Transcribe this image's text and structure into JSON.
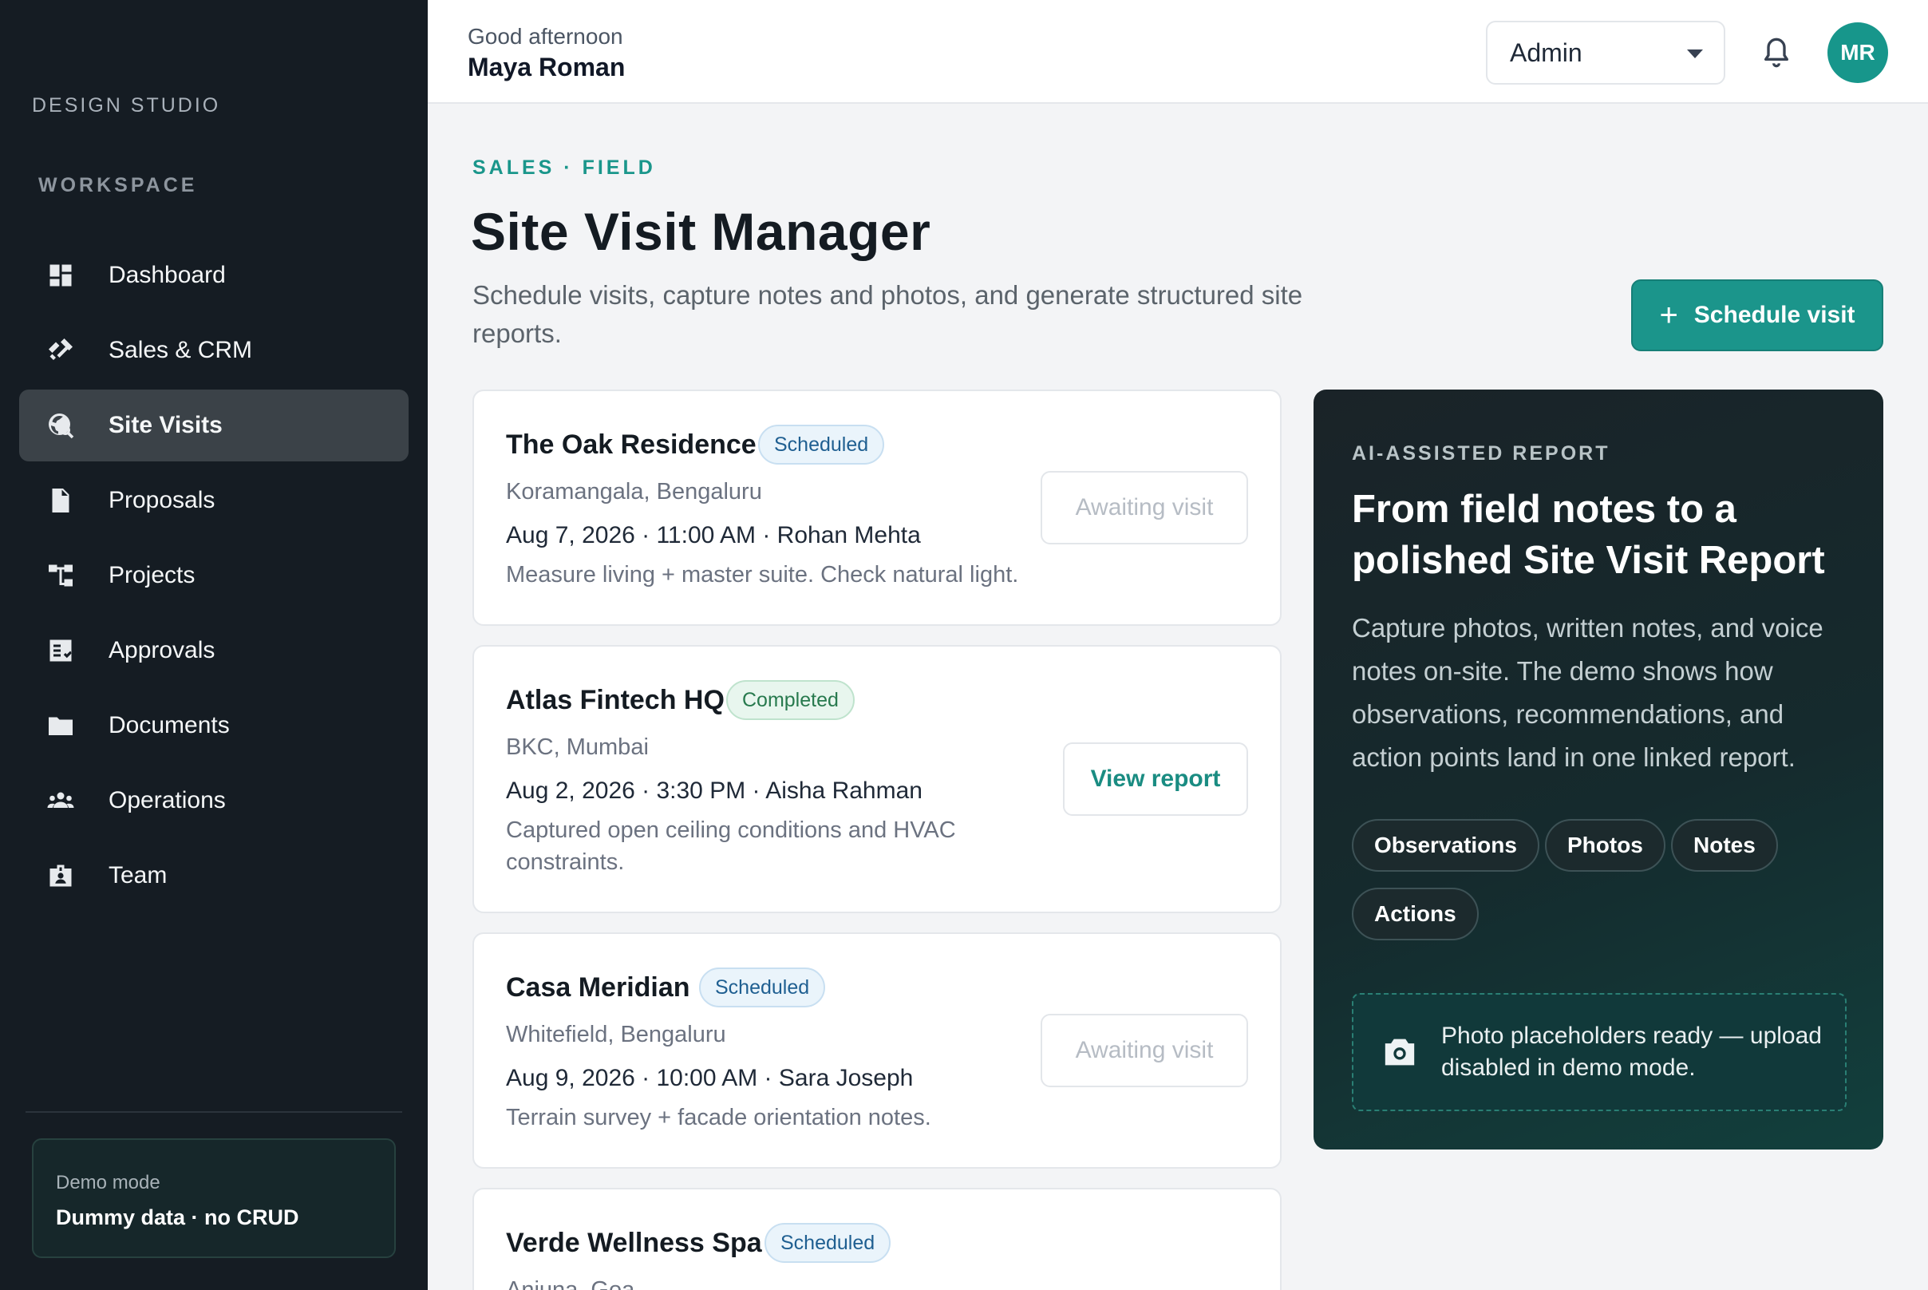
{
  "sidebar": {
    "brand": "DESIGN STUDIO",
    "section_label": "WORKSPACE",
    "items": [
      {
        "label": "Dashboard",
        "icon": "dashboard-icon",
        "active": false
      },
      {
        "label": "Sales & CRM",
        "icon": "handshake-icon",
        "active": false
      },
      {
        "label": "Site Visits",
        "icon": "map-search-icon",
        "active": true
      },
      {
        "label": "Proposals",
        "icon": "document-icon",
        "active": false
      },
      {
        "label": "Projects",
        "icon": "project-tree-icon",
        "active": false
      },
      {
        "label": "Approvals",
        "icon": "approval-icon",
        "active": false
      },
      {
        "label": "Documents",
        "icon": "folder-icon",
        "active": false
      },
      {
        "label": "Operations",
        "icon": "group-icon",
        "active": false
      },
      {
        "label": "Team",
        "icon": "badge-icon",
        "active": false
      }
    ],
    "demo": {
      "small": "Demo mode",
      "main": "Dummy data · no CRUD"
    }
  },
  "header": {
    "greeting": "Good afternoon",
    "user_name": "Maya Roman",
    "role": "Admin",
    "avatar_initials": "MR"
  },
  "page": {
    "eyebrow": "SALES · FIELD",
    "title": "Site Visit Manager",
    "subtitle": "Schedule visits, capture notes and photos, and generate structured site reports.",
    "primary_button": "Schedule visit"
  },
  "visits": [
    {
      "name": "The Oak Residence",
      "status": "Scheduled",
      "location": "Koramangala, Bengaluru",
      "meta": "Aug 7, 2026 · 11:00 AM · Rohan Mehta",
      "note": "Measure living + master suite. Check natural light.",
      "action": "Awaiting visit"
    },
    {
      "name": "Atlas Fintech HQ",
      "status": "Completed",
      "location": "BKC, Mumbai",
      "meta": "Aug 2, 2026 · 3:30 PM · Aisha Rahman",
      "note": "Captured open ceiling conditions and HVAC constraints.",
      "action": "View report"
    },
    {
      "name": "Casa Meridian",
      "status": "Scheduled",
      "location": "Whitefield, Bengaluru",
      "meta": "Aug 9, 2026 · 10:00 AM · Sara Joseph",
      "note": "Terrain survey + facade orientation notes.",
      "action": "Awaiting visit"
    },
    {
      "name": "Verde Wellness Spa",
      "status": "Scheduled",
      "location": "Anjuna, Goa"
    }
  ],
  "report_panel": {
    "eyebrow": "AI-ASSISTED REPORT",
    "title": "From field notes to a polished Site Visit Report",
    "text": "Capture photos, written notes, and voice notes on-site. The demo shows how observations, recommendations, and action points land in one linked report.",
    "chips": [
      "Observations",
      "Photos",
      "Notes",
      "Actions"
    ],
    "upload_note": "Photo placeholders ready — upload disabled in demo mode."
  },
  "colors": {
    "accent": "#1b958b",
    "sidebar_bg": "#151c23",
    "panel_bg": "#152a2d"
  }
}
